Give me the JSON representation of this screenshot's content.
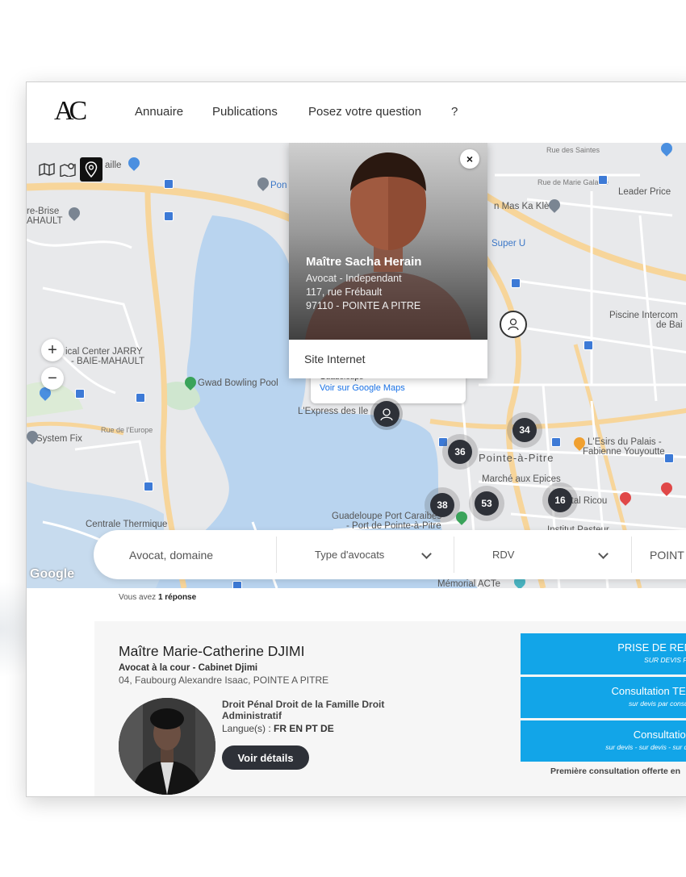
{
  "header": {
    "logo": "AC",
    "nav": [
      "Annuaire",
      "Publications",
      "Posez votre question",
      "?"
    ]
  },
  "map": {
    "labels": {
      "l1": "aille",
      "l2": "Pon",
      "l3": "re-Brise",
      "l4": "AHAULT",
      "l5": "ical Center JARRY",
      "l6": "- BAIE-MAHAULT",
      "l7": "Gwad Bowling Pool",
      "l8": "L'Express des Ile",
      "l9": "System Fix",
      "l10": "Centrale Thermique",
      "l11": "Guadeloupe Port Caraibes",
      "l12": "- Port de Pointe-à-Pitre",
      "l13": "Rue des Saintes",
      "l14": "Rue de Marie Galante",
      "l15": "Leader Price",
      "l16": "n Mas Ka Klè",
      "l17": "Super U",
      "l18": "Piscine Intercom",
      "l19": "de Bai",
      "l20": "L'Esirs du Palais -",
      "l21": "Fabienne Youyoutte",
      "l22": "Pointe-à-Pitre",
      "l23": "Marché aux Epices",
      "l24": "ital Ricou",
      "l25": "Mémorial ACTe",
      "l26": "Institut Pasteur",
      "l27": "Rue de l'Europe"
    },
    "clusters": [
      "34",
      "36",
      "38",
      "53",
      "16"
    ],
    "google": "Google",
    "zoom_in": "+",
    "zoom_out": "−"
  },
  "popup": {
    "close": "×",
    "name": "Maître Sacha Herain",
    "role": "Avocat - Independant",
    "street": "117, rue Frébault",
    "city": "97110 - POINTE A PITRE",
    "site": "Site Internet",
    "tip_title": "Guadeloupe",
    "tip_link": "Voir sur Google Maps"
  },
  "search": {
    "keyword_placeholder": "Avocat, domaine",
    "type_label": "Type d'avocats",
    "rdv_label": "RDV",
    "location": "POINT"
  },
  "results": {
    "count_prefix": "Vous avez",
    "count_value": "1 réponse"
  },
  "lawyer": {
    "name": "Maître Marie-Catherine DJIMI",
    "title": "Avocat à la cour - Cabinet Djimi",
    "address": "04, Faubourg Alexandre Isaac, POINTE A PITRE",
    "domains": "Droit Pénal Droit de la Famille Droit Administratif",
    "lang_label": "Langue(s) :",
    "langs": "FR EN PT DE",
    "details_button": "Voir détails",
    "cta1": "PRISE DE REN",
    "cta1_sub": "SUR DEVIS PA",
    "cta2": "Consultation TEL",
    "cta2_sub": "sur devis par consult",
    "cta3": "Consultation",
    "cta3_sub": "sur devis - sur devis - sur de",
    "note": "Première consultation offerte en"
  },
  "colors": {
    "accent": "#12a5e8",
    "cluster": "#2e3138",
    "water": "#b9d4ef",
    "road": "#f7d59a"
  }
}
